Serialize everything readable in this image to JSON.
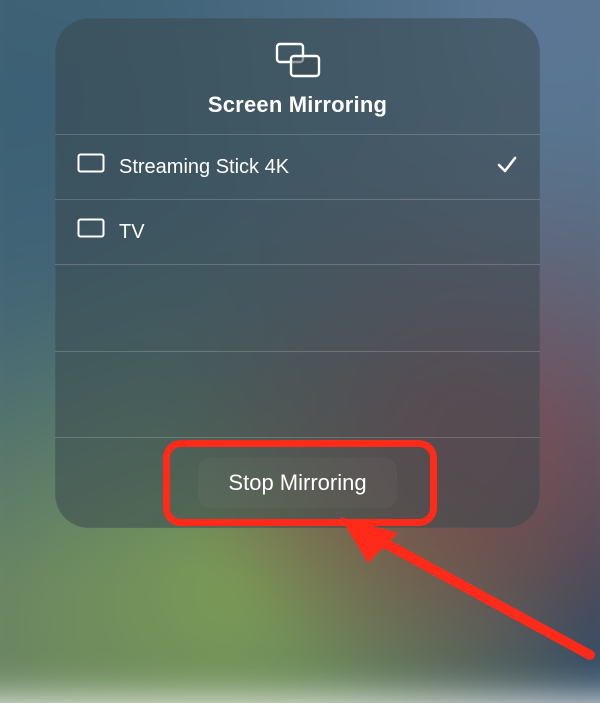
{
  "panel": {
    "title": "Screen Mirroring"
  },
  "devices": [
    {
      "label": "Streaming Stick 4K",
      "selected": true
    },
    {
      "label": "TV",
      "selected": false
    }
  ],
  "footer": {
    "stop_label": "Stop Mirroring"
  },
  "annotation": {
    "highlight_color": "#ff2a1a"
  }
}
